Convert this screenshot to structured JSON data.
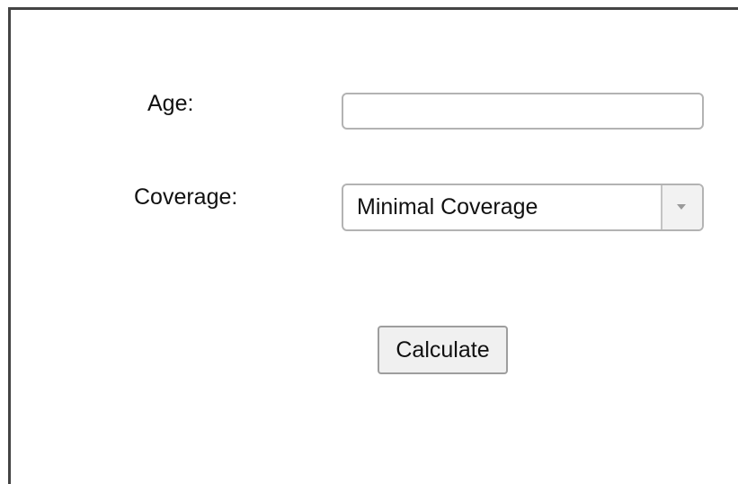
{
  "form": {
    "age_label": "Age:",
    "age_value": "",
    "coverage_label": "Coverage:",
    "coverage_selected": "Minimal Coverage",
    "calculate_label": "Calculate"
  },
  "icons": {
    "dropdown": "chevron-down-icon"
  }
}
